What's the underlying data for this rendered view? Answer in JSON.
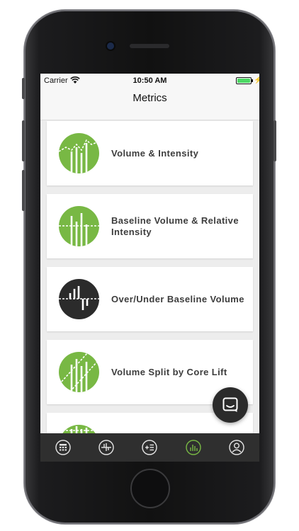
{
  "status_bar": {
    "carrier": "Carrier",
    "time": "10:50 AM"
  },
  "nav": {
    "title": "Metrics"
  },
  "metrics": [
    {
      "label": "Volume & Intensity",
      "icon": "volume-intensity-icon",
      "color": "#78b844"
    },
    {
      "label": "Baseline Volume & Relative Intensity",
      "icon": "baseline-volume-icon",
      "color": "#78b844"
    },
    {
      "label": "Over/Under Baseline Volume",
      "icon": "over-under-baseline-icon",
      "color": "#2b2b2b"
    },
    {
      "label": "Volume Split by Core Lift",
      "icon": "volume-split-icon",
      "color": "#78b844"
    }
  ],
  "tab_bar": {
    "items": [
      {
        "name": "calculator",
        "icon": "calculator-icon"
      },
      {
        "name": "baseline",
        "icon": "baseline-icon"
      },
      {
        "name": "logging",
        "icon": "add-list-icon"
      },
      {
        "name": "metrics",
        "icon": "bar-chart-icon",
        "active": true
      },
      {
        "name": "profile",
        "icon": "profile-icon"
      }
    ]
  },
  "colors": {
    "accent": "#78b844",
    "tab_bar": "#2f2f2f",
    "dark_icon": "#2b2b2b"
  }
}
